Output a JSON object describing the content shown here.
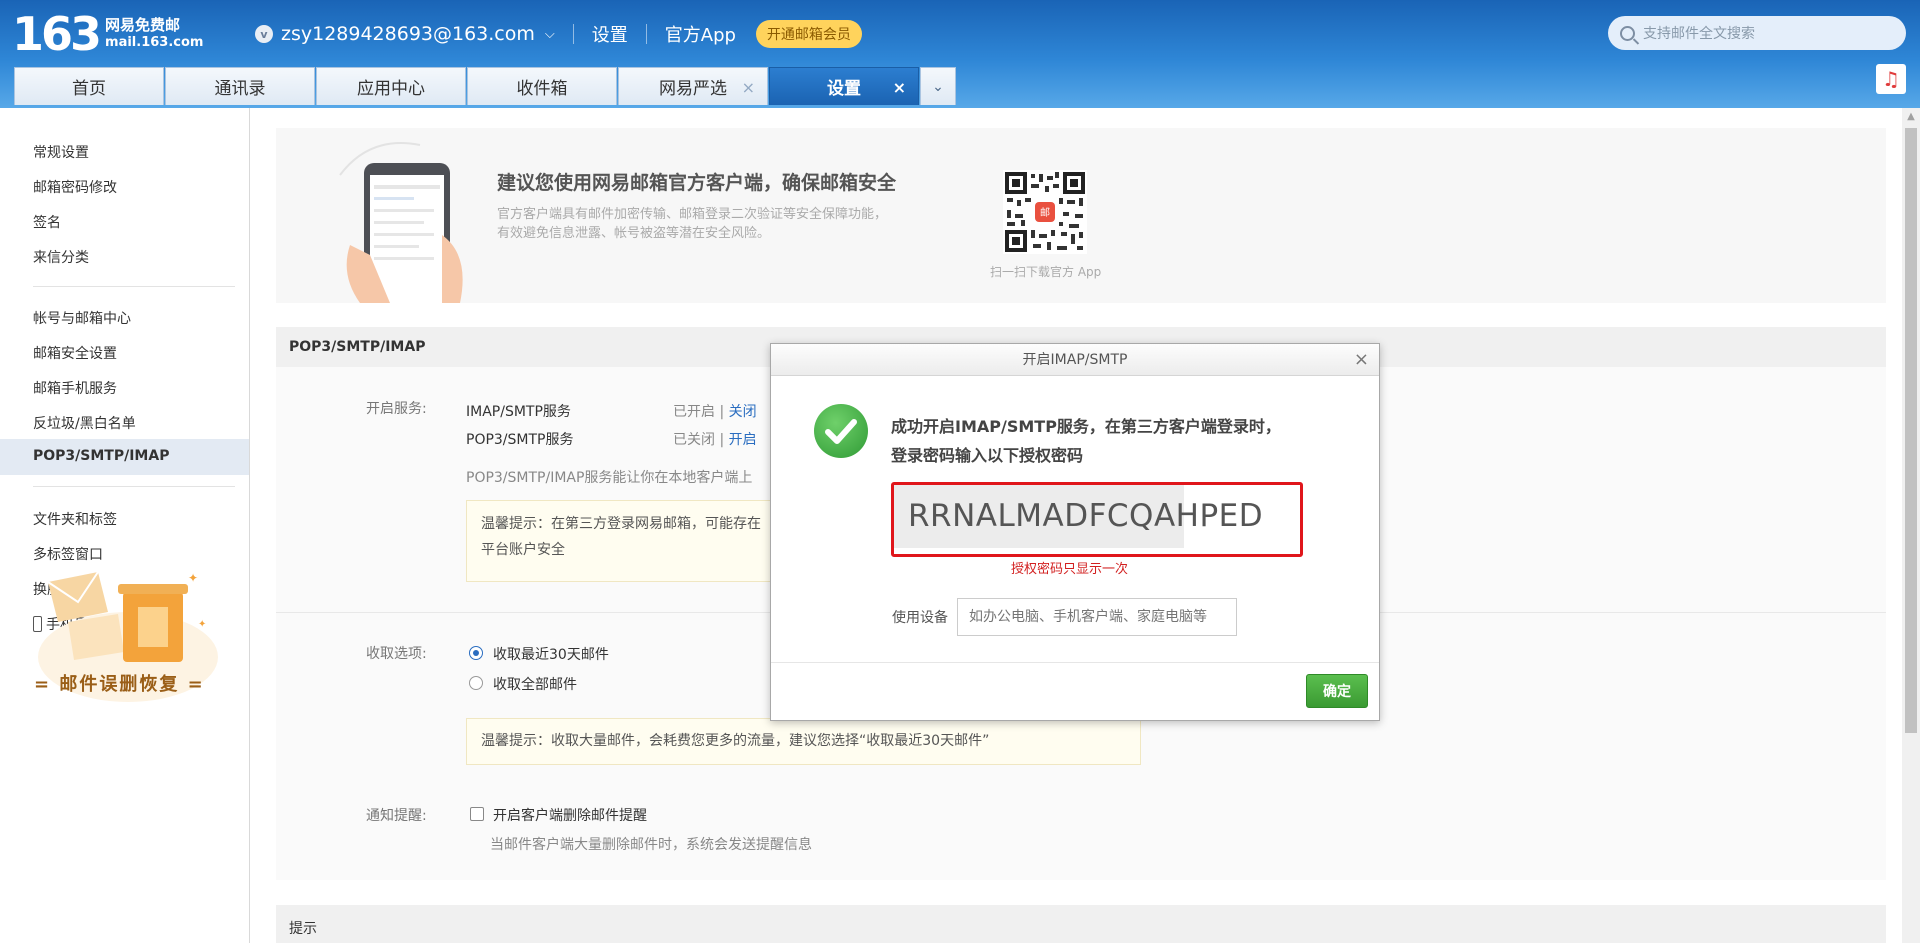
{
  "header": {
    "logo_number": "163",
    "logo_cn": "网易免费邮",
    "logo_en": "mail.163.com",
    "account_badge": "v",
    "account": "zsy1289428693@163.com",
    "settings_link": "设置",
    "app_link": "官方App",
    "vip_button": "开通邮箱会员",
    "search_placeholder": "支持邮件全文搜索",
    "music_icon": "♫"
  },
  "tabs": [
    {
      "label": "首页"
    },
    {
      "label": "通讯录"
    },
    {
      "label": "应用中心"
    },
    {
      "label": "收件箱"
    },
    {
      "label": "网易严选"
    },
    {
      "label": "设置"
    }
  ],
  "sidebar": {
    "group1": [
      "常规设置",
      "邮箱密码修改",
      "签名",
      "来信分类"
    ],
    "group2": [
      "帐号与邮箱中心",
      "邮箱安全设置",
      "邮箱手机服务",
      "反垃圾/黑白名单",
      "POP3/SMTP/IMAP"
    ],
    "group3": [
      "文件夹和标签",
      "多标签窗口",
      "换肤",
      "手机号码邮箱"
    ],
    "promo_title": "= 邮件误删恢复 ="
  },
  "banner": {
    "title": "建议您使用网易邮箱官方客户端，确保邮箱安全",
    "desc": "官方客户端具有邮件加密传输、邮箱登录二次验证等安全保障功能，有效避免信息泄露、帐号被盗等潜在安全风险。",
    "qr_caption": "扫一扫下载官方 App"
  },
  "pop": {
    "title": "POP3/SMTP/IMAP",
    "service_label": "开启服务:",
    "imap_name": "IMAP/SMTP服务",
    "imap_status": "已开启",
    "imap_action": "关闭",
    "pop_name": "POP3/SMTP服务",
    "pop_status": "已关闭",
    "pop_action": "开启",
    "divider": "|",
    "desc": "POP3/SMTP/IMAP服务能让你在本地客户端上",
    "tip_line1": "温馨提示：在第三方登录网易邮箱，可能存在",
    "tip_line2": "平台账户安全",
    "receive_label": "收取选项:",
    "receive_opt1": "收取最近30天邮件",
    "receive_opt2": "收取全部邮件",
    "receive_tip": "温馨提示：收取大量邮件，会耗费您更多的流量，建议您选择“收取最近30天邮件”",
    "notify_label": "通知提醒:",
    "notify_opt": "开启客户端删除邮件提醒",
    "notify_desc": "当邮件客户端大量删除邮件时，系统会发送提醒信息"
  },
  "hint": {
    "title": "提示"
  },
  "dialog": {
    "title": "开启IMAP/SMTP",
    "close": "×",
    "message": "成功开启IMAP/SMTP服务，在第三方客户端登录时，登录密码输入以下授权密码",
    "auth_code": "RRNALMADFCQAHPED",
    "code_note": "授权密码只显示一次",
    "device_label": "使用设备",
    "device_placeholder": "如办公电脑、手机客户端、家庭电脑等",
    "ok_button": "确定"
  }
}
